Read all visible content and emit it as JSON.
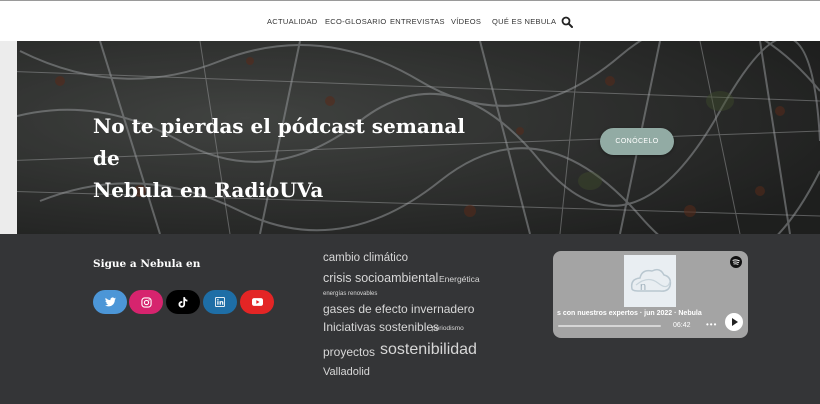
{
  "nav": {
    "items": [
      "ACTUALIDAD",
      "ECO-GLOSARIO",
      "ENTREVISTAS",
      "VÍDEOS",
      "QUÉ ES NEBULA"
    ],
    "search_icon": "search-icon"
  },
  "hero": {
    "title_line1": "No te pierdas el pódcast semanal de",
    "title_line2": "Nebula en RadioUVa",
    "button_label": "CONÓCELO"
  },
  "footer": {
    "follow_title": "Sigue a Nebula en",
    "social": [
      {
        "name": "twitter",
        "color": "#4c96d7"
      },
      {
        "name": "instagram",
        "color": "#d6246e"
      },
      {
        "name": "tiktok",
        "color": "#000000"
      },
      {
        "name": "linkedin",
        "color": "#1e6ea6"
      },
      {
        "name": "youtube",
        "color": "#e32525"
      }
    ],
    "tags": [
      "cambio climático",
      "crisis socioambiental",
      "Energética",
      "energías renovables",
      "gases de efecto invernadero",
      "Iniciativas sostenibles",
      "periodismo",
      "proyectos",
      "sostenibilidad",
      "Valladolid"
    ]
  },
  "embed": {
    "track": "s con nuestros expertos · jun 2022 · Nebula",
    "time": "06:42",
    "more": "•••",
    "colors": {
      "background": "#a4a4a4"
    }
  }
}
